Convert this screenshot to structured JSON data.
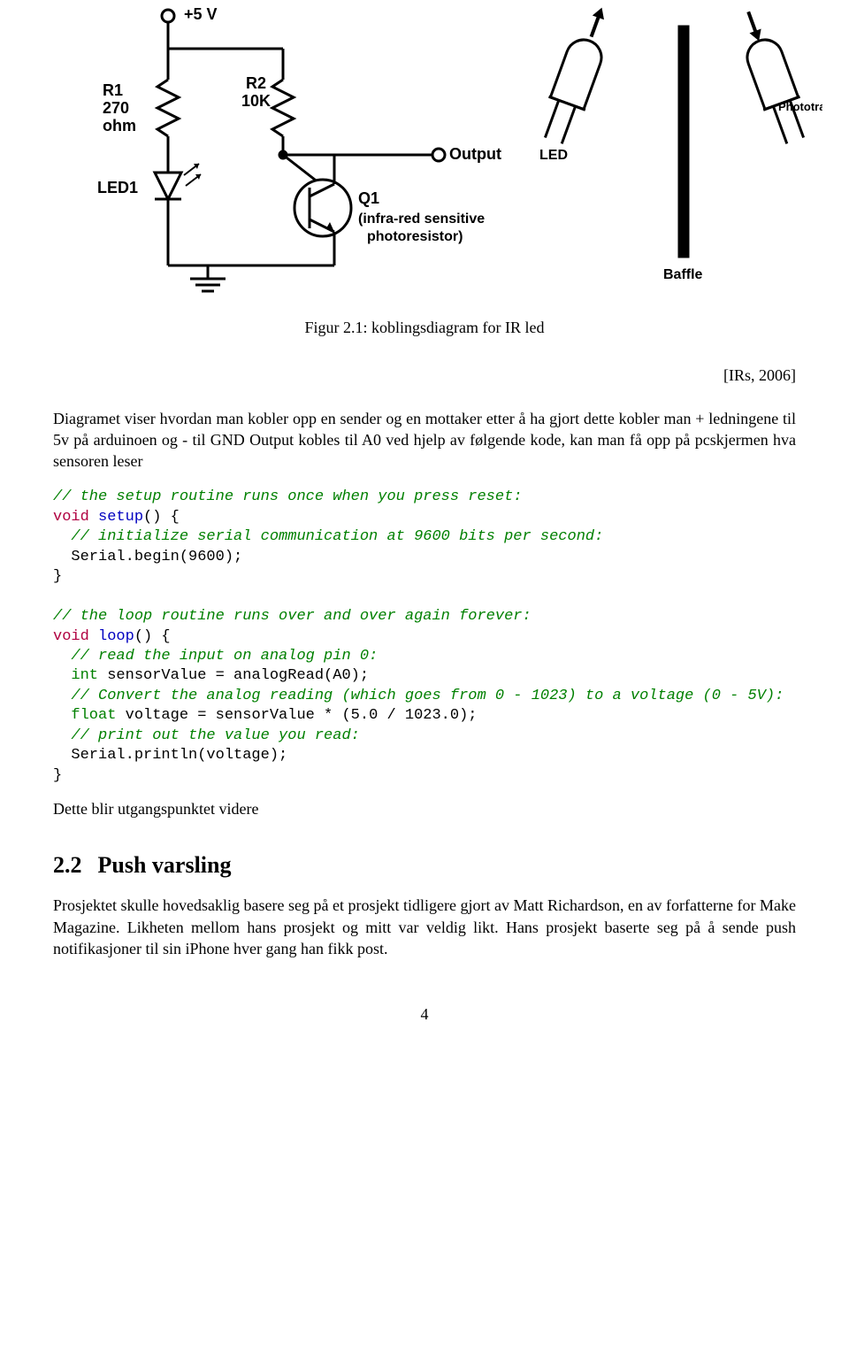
{
  "figure": {
    "labels": {
      "vcc": "+5 V",
      "r1_name": "R1",
      "r1_value": "270",
      "r1_unit": "ohm",
      "r2_name": "R2",
      "r2_value": "10K",
      "led1": "LED1",
      "q1_name": "Q1",
      "q1_desc1": "(infra-red sensitive",
      "q1_desc2": "photoresistor)",
      "output": "Output",
      "led_right": "LED",
      "photo_right": "Phototransistor",
      "baffle": "Baffle"
    },
    "caption": "Figur 2.1: koblingsdiagram for IR led",
    "citation": "[IRs, 2006]"
  },
  "paragraphs": {
    "p1": "Diagramet viser hvordan man kobler opp en sender og en mottaker etter å ha gjort dette kobler man + ledningene til 5v på arduinoen og - til GND Output kobles til A0 ved hjelp av følgende kode, kan man få opp på pcskjermen hva sensoren leser",
    "p2": "Dette blir utgangspunktet videre",
    "p3": "Prosjektet skulle hovedsaklig basere seg på et prosjekt tidligere gjort av Matt Richardson, en av forfatterne for Make Magazine. Likheten mellom hans prosjekt og mitt var veldig likt. Hans prosjekt baserte seg på å sende push notifikasjoner til sin iPhone hver gang han fikk post."
  },
  "code": {
    "l1": "// the setup routine runs once when you press reset:",
    "l2a": "void",
    "l2b": " ",
    "l2c": "setup",
    "l2d": "() {",
    "l3": "  // initialize serial communication at 9600 bits per second:",
    "l4": "  Serial.begin(9600);",
    "l5": "}",
    "l6": "",
    "l7": "// the loop routine runs over and over again forever:",
    "l8a": "void",
    "l8b": " ",
    "l8c": "loop",
    "l8d": "() {",
    "l9": "  // read the input on analog pin 0:",
    "l10a": "  ",
    "l10b": "int",
    "l10c": " sensorValue = analogRead(A0);",
    "l11": "  // Convert the analog reading (which goes from 0 - 1023) to a voltage (0 - 5V):",
    "l12a": "  ",
    "l12b": "float",
    "l12c": " voltage = sensorValue * (5.0 / 1023.0);",
    "l13": "  // print out the value you read:",
    "l14": "  Serial.println(voltage);",
    "l15": "}"
  },
  "section": {
    "number": "2.2",
    "title": "Push varsling"
  },
  "page_number": "4"
}
